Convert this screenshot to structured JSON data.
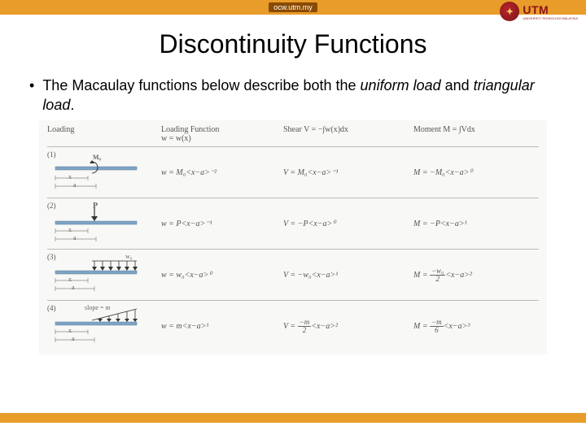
{
  "header": {
    "ocw": "ocw.utm.my",
    "logo_text": "UTM",
    "logo_sub": "UNIVERSITI TEKNOLOGI MALAYSIA"
  },
  "title": "Discontinuity Functions",
  "bullet": {
    "pre": "The Macaulay functions below describe both the ",
    "em1": "uniform load",
    "mid": " and ",
    "em2": "triangular load",
    "post": "."
  },
  "table": {
    "headers": {
      "loading": "Loading",
      "func_l1": "Loading Function",
      "func_l2": "w = w(x)",
      "shear": "Shear V = −∫w(x)dx",
      "moment": "Moment M = ∫Vdx"
    },
    "rows": [
      {
        "n": "(1)",
        "label_top": "M₀",
        "dim_x": "x",
        "dim_a": "a",
        "w": "w = M₀<x−a>⁻²",
        "V": "V = M₀<x−a>⁻¹",
        "M": "M = −M₀<x−a>⁰"
      },
      {
        "n": "(2)",
        "label_top": "P",
        "dim_x": "x",
        "dim_a": "a",
        "w": "w = P<x−a>⁻¹",
        "V": "V = −P<x−a>⁰",
        "M": "M = −P<x−a>¹"
      },
      {
        "n": "(3)",
        "label_top": "w₀",
        "dim_x": "x",
        "dim_a": "a",
        "w": "w = w₀<x−a>⁰",
        "V": "V = −w₀<x−a>¹",
        "M_pre": "M = ",
        "M_num": "−w₀",
        "M_den": "2",
        "M_post": "<x−a>²"
      },
      {
        "n": "(4)",
        "label_top": "slope = m",
        "dim_x": "x",
        "dim_a": "a",
        "w": "w = m<x−a>¹",
        "V_pre": "V = ",
        "V_num": "−m",
        "V_den": "2",
        "V_post": "<x−a>²",
        "M_pre": "M = ",
        "M_num": "−m",
        "M_den": "6",
        "M_post": "<x−a>³"
      }
    ]
  }
}
